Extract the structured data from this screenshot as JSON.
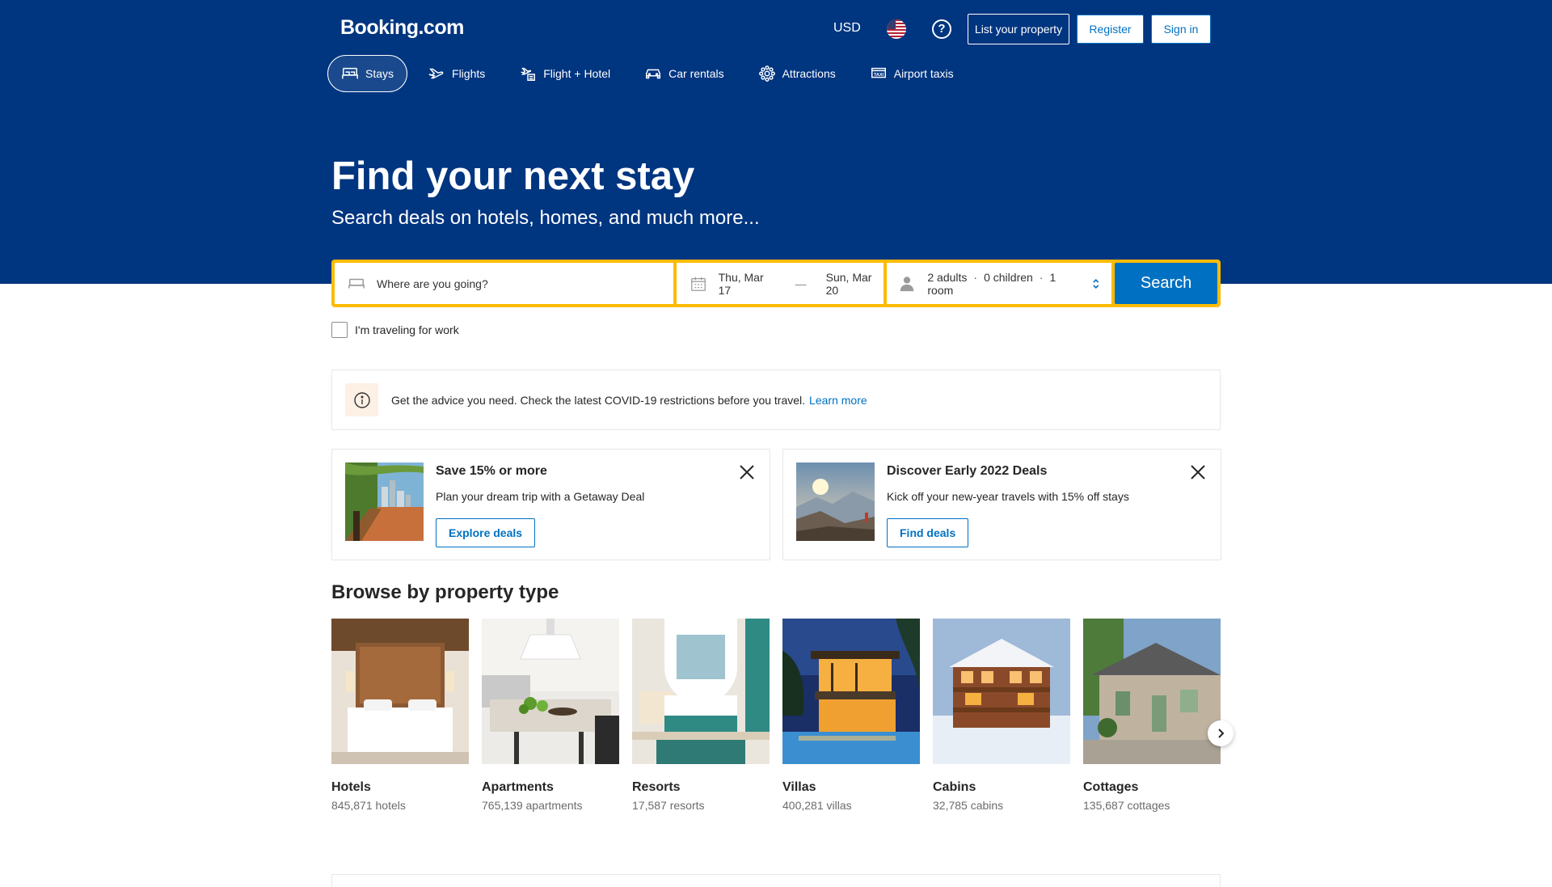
{
  "header": {
    "logo": "Booking.com",
    "currency": "USD",
    "list_property": "List your property",
    "register": "Register",
    "sign_in": "Sign in"
  },
  "nav": {
    "items": [
      {
        "label": "Stays",
        "icon": "bed-icon",
        "active": true
      },
      {
        "label": "Flights",
        "icon": "plane-icon"
      },
      {
        "label": "Flight + Hotel",
        "icon": "flight-hotel-icon"
      },
      {
        "label": "Car rentals",
        "icon": "car-icon"
      },
      {
        "label": "Attractions",
        "icon": "attractions-icon"
      },
      {
        "label": "Airport taxis",
        "icon": "taxi-icon"
      }
    ]
  },
  "hero": {
    "title": "Find your next stay",
    "subtitle": "Search deals on hotels, homes, and much more..."
  },
  "search": {
    "destination_placeholder": "Where are you going?",
    "check_in": "Thu, Mar 17",
    "check_out": "Sun, Mar 20",
    "adults": "2 adults",
    "children": "0 children",
    "rooms": "1 room",
    "button": "Search",
    "work_label": "I'm traveling for work"
  },
  "covid": {
    "text": "Get the advice you need. Check the latest COVID-19 restrictions before you travel.",
    "link": "Learn more"
  },
  "promos": [
    {
      "title": "Save 15% or more",
      "desc": "Plan your dream trip with a Getaway Deal",
      "button": "Explore deals"
    },
    {
      "title": "Discover Early 2022 Deals",
      "desc": "Kick off your new-year travels with 15% off stays",
      "button": "Find deals"
    }
  ],
  "browse": {
    "title": "Browse by property type",
    "cards": [
      {
        "name": "Hotels",
        "count": "845,871 hotels"
      },
      {
        "name": "Apartments",
        "count": "765,139 apartments"
      },
      {
        "name": "Resorts",
        "count": "17,587 resorts"
      },
      {
        "name": "Villas",
        "count": "400,281 villas"
      },
      {
        "name": "Cabins",
        "count": "32,785 cabins"
      },
      {
        "name": "Cottages",
        "count": "135,687 cottages"
      }
    ]
  },
  "colors": {
    "brand_blue": "#003580",
    "accent_blue": "#0071c2",
    "search_yellow": "#febb02"
  }
}
